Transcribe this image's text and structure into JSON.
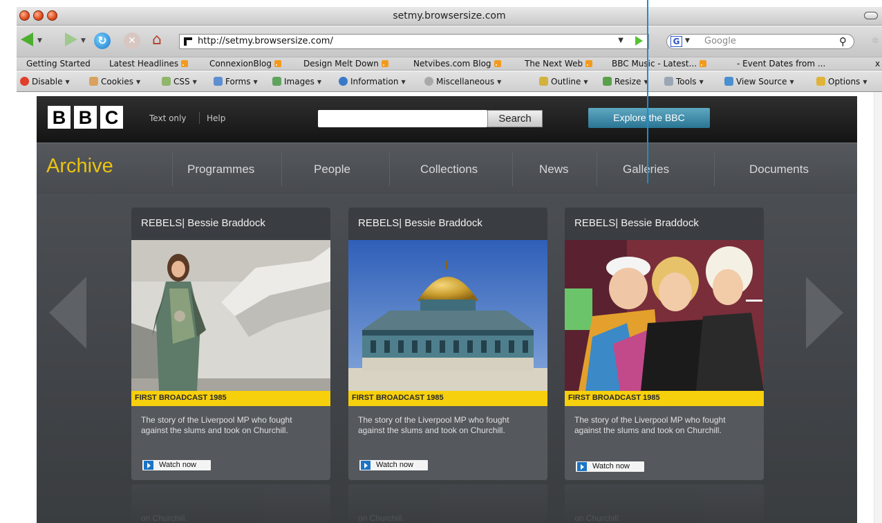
{
  "window": {
    "title": "setmy.browsersize.com"
  },
  "toolbar": {
    "url": "http://setmy.browsersize.com/",
    "search_placeholder": "Google"
  },
  "bookmarks": [
    {
      "label": "Getting Started",
      "rss": false
    },
    {
      "label": "Latest Headlines",
      "rss": true
    },
    {
      "label": "ConnexionBlog",
      "rss": true
    },
    {
      "label": "Design Melt Down",
      "rss": true
    },
    {
      "label": "Netvibes.com Blog",
      "rss": true
    },
    {
      "label": "The Next Web",
      "rss": true
    },
    {
      "label": "BBC Music - Latest...",
      "rss": true
    },
    {
      "label": "- Event Dates from ...",
      "rss": false
    },
    {
      "label": "x",
      "rss": false
    }
  ],
  "devbar": [
    {
      "label": "Disable",
      "icon": "disable-icon",
      "color": "#e0402a"
    },
    {
      "label": "Cookies",
      "icon": "cookies-icon",
      "color": "#d9a25e"
    },
    {
      "label": "CSS",
      "icon": "css-icon",
      "color": "#8fb66b"
    },
    {
      "label": "Forms",
      "icon": "forms-icon",
      "color": "#5d8fd1"
    },
    {
      "label": "Images",
      "icon": "images-icon",
      "color": "#5fa35f"
    },
    {
      "label": "Information",
      "icon": "information-icon",
      "color": "#3a79c8"
    },
    {
      "label": "Miscellaneous",
      "icon": "miscellaneous-icon",
      "color": "#a9a9a9"
    },
    {
      "label": "Outline",
      "icon": "outline-icon",
      "color": "#d3b23e"
    },
    {
      "label": "Resize",
      "icon": "resize-icon",
      "color": "#5aa04a"
    },
    {
      "label": "Tools",
      "icon": "tools-icon",
      "color": "#9aa6b4"
    },
    {
      "label": "View Source",
      "icon": "view-source-icon",
      "color": "#4a8fd0"
    },
    {
      "label": "Options",
      "icon": "options-icon",
      "color": "#e0b43a"
    }
  ],
  "bbc": {
    "logo_letters": [
      "B",
      "B",
      "C"
    ],
    "text_only": "Text only",
    "help": "Help",
    "search_button": "Search",
    "explore": "Explore the BBC"
  },
  "archive": {
    "title": "Archive",
    "nav": [
      "Programmes",
      "People",
      "Collections",
      "News",
      "Galleries",
      "Documents"
    ]
  },
  "cards": [
    {
      "title": "REBELS| Bessie Braddock",
      "band": "FIRST BROADCAST 1985",
      "description": "The story of the Liverpool MP who fought against the slums and took on Churchill.",
      "watch": "Watch now"
    },
    {
      "title": "REBELS| Bessie Braddock",
      "band": "FIRST BROADCAST 1985",
      "description": "The story of the Liverpool MP who fought against the slums and took on Churchill.",
      "watch": "Watch now"
    },
    {
      "title": "REBELS| Bessie Braddock",
      "band": "FIRST BROADCAST 1985",
      "description": "The story of the Liverpool MP who fought against the slums and took on Churchill.",
      "watch": "Watch now"
    }
  ],
  "ghost_text": "on Churchill.",
  "colors": {
    "accent_yellow": "#f6cf0d",
    "archive_gold": "#e9c313",
    "explore_blue": "#2a7594",
    "pointer_blue": "#1a8fd1"
  }
}
